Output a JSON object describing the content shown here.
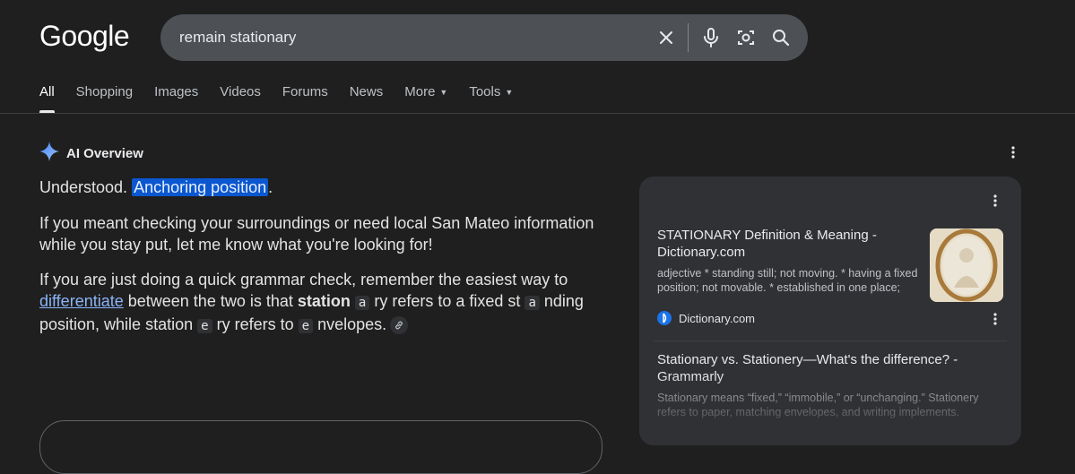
{
  "logo": "Google",
  "search": {
    "query": "remain stationary"
  },
  "tabs": [
    {
      "label": "All"
    },
    {
      "label": "Shopping"
    },
    {
      "label": "Images"
    },
    {
      "label": "Videos"
    },
    {
      "label": "Forums"
    },
    {
      "label": "News"
    },
    {
      "label": "More"
    },
    {
      "label": "Tools"
    }
  ],
  "ai_overview": {
    "heading": "AI Overview",
    "p1": {
      "lead": "Understood. ",
      "highlight": "Anchoring position",
      "tail": "."
    },
    "p2": "If you meant checking your surroundings or need local San Mateo information while you stay put, let me know what you're looking for!",
    "p3": {
      "t1": "If you are just doing a quick grammar check, remember the easiest way to ",
      "link": "differentiate",
      "t2": " between the two is that ",
      "bold": "station",
      "code1": "a",
      "t3": "ry refers to a fixed st",
      "code2": "a",
      "t4": "nding position, while station",
      "code3": "e",
      "t5": "ry refers to ",
      "code4": "e",
      "t6": "nvelopes."
    }
  },
  "sources": [
    {
      "title": "STATIONARY Definition & Meaning - Dictionary.com",
      "snippet": "adjective * standing still; not moving. * having a fixed position; not movable. * established in one place; not...",
      "site": "Dictionary.com"
    },
    {
      "title": "Stationary vs. Stationery—What's the difference? - Grammarly",
      "snippet": "Stationary means “fixed,” “immobile,” or “unchanging.” Stationery refers to paper, matching envelopes, and writing implements."
    }
  ],
  "colors": {
    "background": "#1f1f1f",
    "search_box": "#4d5156",
    "link": "#8ab4f8",
    "highlight": "#0b57d0",
    "panel": "#303134"
  }
}
